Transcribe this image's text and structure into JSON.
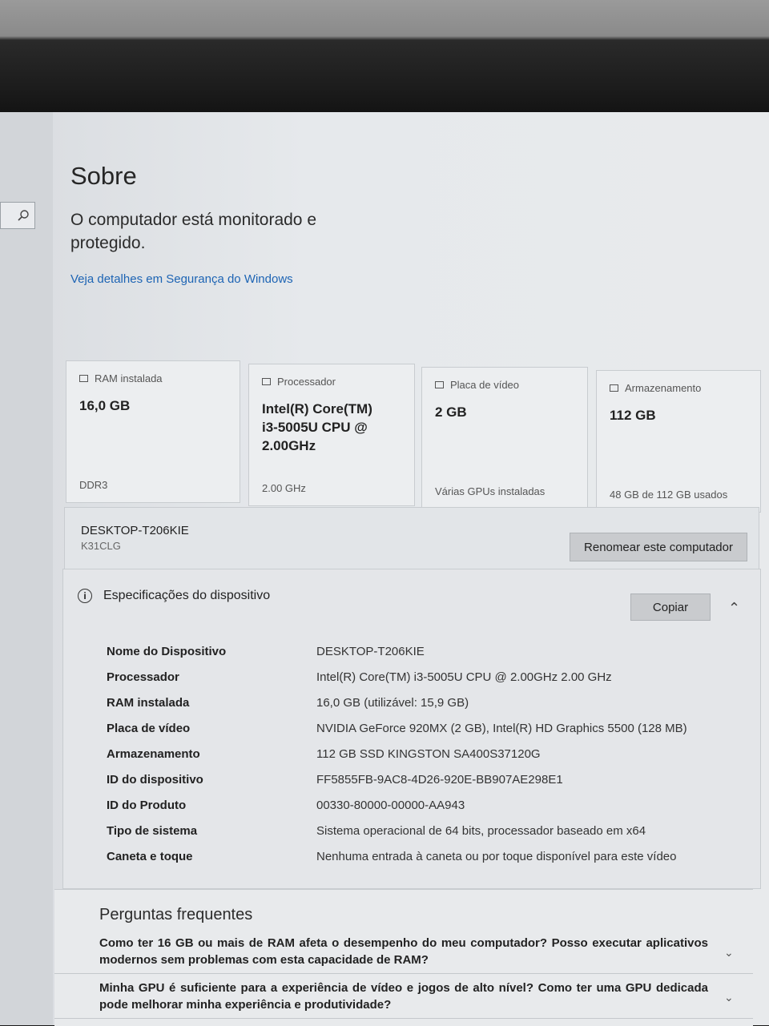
{
  "page": {
    "title": "Sobre",
    "protection_status": "O computador está monitorado e protegido.",
    "security_link": "Veja detalhes em Segurança do Windows"
  },
  "cards": [
    {
      "icon": "ram-icon",
      "label": "RAM instalada",
      "value": "16,0 GB",
      "sub": "DDR3"
    },
    {
      "icon": "processor-icon",
      "label": "Processador",
      "value": "Intel(R) Core(TM) i3-5005U CPU @ 2.00GHz",
      "sub": "2.00 GHz"
    },
    {
      "icon": "gpu-icon",
      "label": "Placa de vídeo",
      "value": "2 GB",
      "sub": "Várias GPUs instaladas"
    },
    {
      "icon": "storage-icon",
      "label": "Armazenamento",
      "value": "112 GB",
      "sub": "48 GB de 112 GB usados"
    }
  ],
  "computer": {
    "name": "DESKTOP-T206KIE",
    "model": "K31CLG",
    "rename_label": "Renomear este computador"
  },
  "specs": {
    "title": "Especificações do dispositivo",
    "copy_label": "Copiar",
    "rows": [
      {
        "key": "Nome do Dispositivo",
        "value": "DESKTOP-T206KIE"
      },
      {
        "key": "Processador",
        "value": "Intel(R) Core(TM) i3-5005U CPU @ 2.00GHz   2.00 GHz"
      },
      {
        "key": "RAM instalada",
        "value": "16,0 GB (utilizável: 15,9 GB)"
      },
      {
        "key": "Placa de vídeo",
        "value": "NVIDIA GeForce 920MX (2 GB), Intel(R) HD Graphics 5500 (128 MB)"
      },
      {
        "key": "Armazenamento",
        "value": "112 GB SSD KINGSTON SA400S37120G"
      },
      {
        "key": "ID do dispositivo",
        "value": "FF5855FB-9AC8-4D26-920E-BB907AE298E1"
      },
      {
        "key": "ID do Produto",
        "value": "00330-80000-00000-AA943"
      },
      {
        "key": "Tipo de sistema",
        "value": "Sistema operacional de 64 bits, processador baseado em x64"
      },
      {
        "key": "Caneta e toque",
        "value": "Nenhuma entrada à caneta ou por toque disponível para este vídeo"
      }
    ]
  },
  "faq": {
    "title": "Perguntas frequentes",
    "items": [
      "Como ter 16 GB ou mais de RAM afeta o desempenho do meu computador? Posso executar aplicativos modernos sem problemas com esta capacidade de RAM?",
      "Minha GPU é suficiente para a experiência de vídeo e jogos de alto nível? Como ter uma GPU dedicada pode melhorar minha experiência e produtividade?"
    ]
  }
}
